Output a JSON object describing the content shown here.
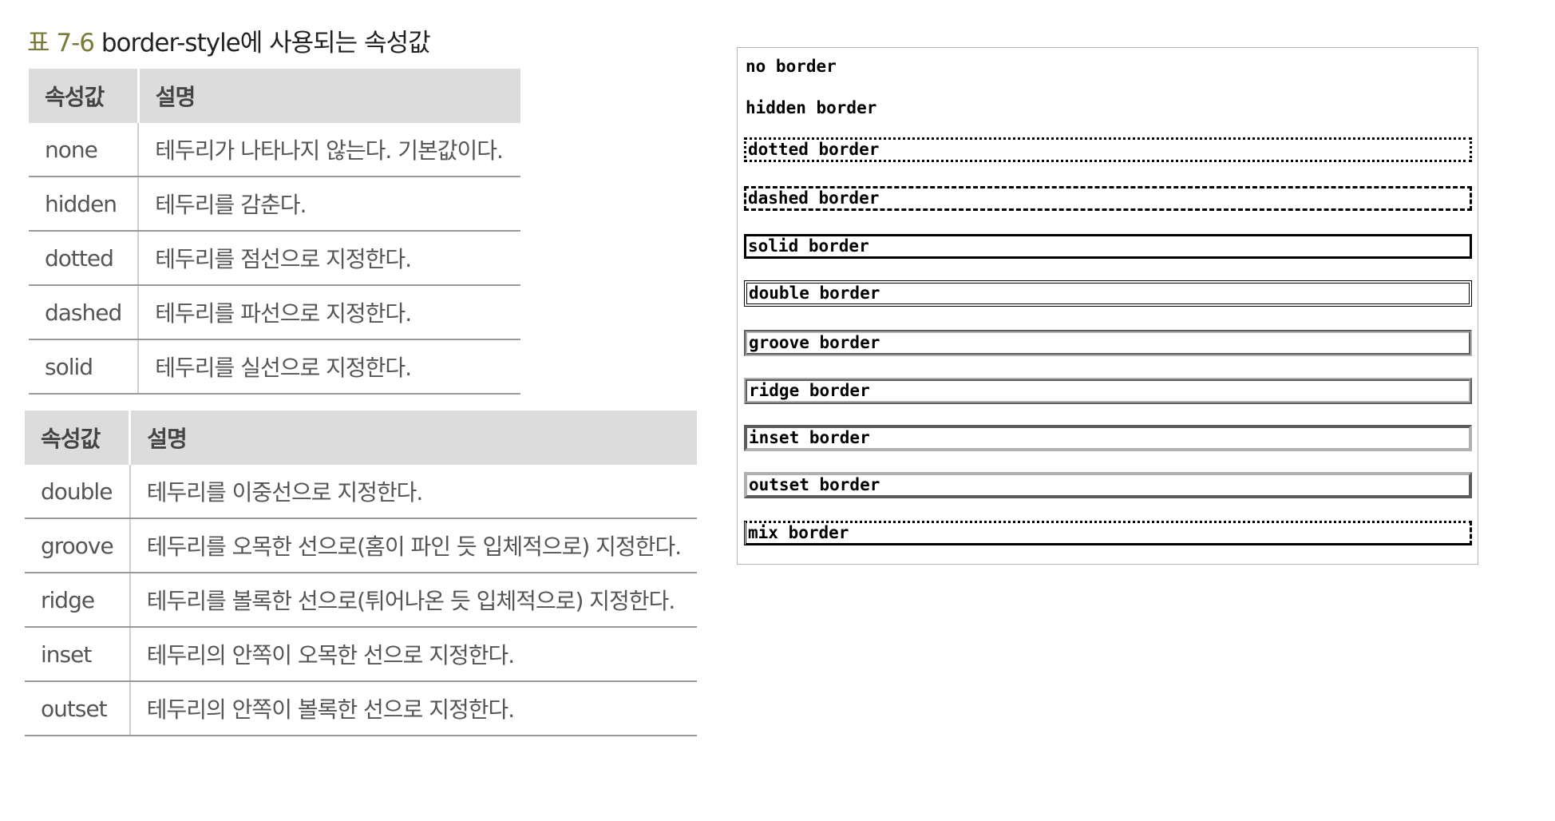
{
  "caption": {
    "label": "표 7-6",
    "text": " border-style에 사용되는 속성값"
  },
  "table1": {
    "headers": [
      "속성값",
      "설명"
    ],
    "rows": [
      [
        "none",
        "테두리가 나타나지 않는다. 기본값이다."
      ],
      [
        "hidden",
        "테두리를 감춘다."
      ],
      [
        "dotted",
        "테두리를 점선으로 지정한다."
      ],
      [
        "dashed",
        "테두리를 파선으로 지정한다."
      ],
      [
        "solid",
        "테두리를 실선으로 지정한다."
      ]
    ]
  },
  "table2": {
    "headers": [
      "속성값",
      "설명"
    ],
    "rows": [
      [
        "double",
        "테두리를 이중선으로 지정한다."
      ],
      [
        "groove",
        "테두리를 오목한 선으로(홈이 파인 듯 입체적으로) 지정한다."
      ],
      [
        "ridge",
        "테두리를 볼록한 선으로(튀어나온 듯 입체적으로) 지정한다."
      ],
      [
        "inset",
        "테두리의 안쪽이 오목한 선으로 지정한다."
      ],
      [
        "outset",
        "테두리의 안쪽이 볼록한 선으로 지정한다."
      ]
    ]
  },
  "demo": {
    "items": [
      "no border",
      "hidden border",
      "dotted border",
      "dashed border",
      "solid border",
      "double border",
      "groove border",
      "ridge border",
      "inset border",
      "outset border",
      "mix border"
    ]
  }
}
